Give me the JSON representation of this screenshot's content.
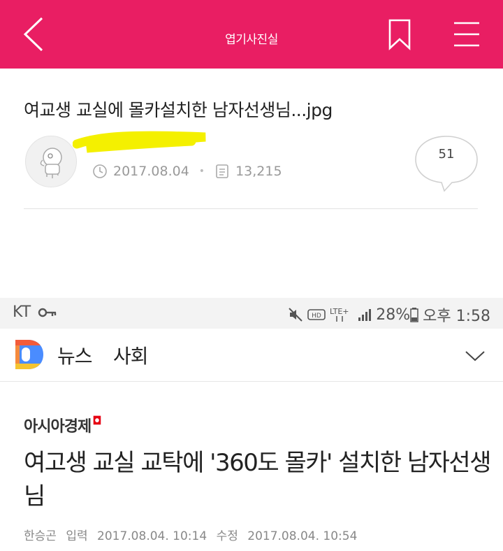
{
  "header": {
    "title": "엽기사진실",
    "background": "#e91e63",
    "icons": [
      "chevron-left-icon",
      "bookmark-icon",
      "hamburger-menu-icon"
    ]
  },
  "post": {
    "title": "여교생 교실에 몰카설치한 남자선생님...jpg",
    "date": "2017.08.04",
    "views": "13,215",
    "comment_count": "51"
  },
  "screenshot": {
    "status_bar": {
      "carrier": "KT",
      "network": "LTE+",
      "battery": "28%",
      "time": "오후 1:58"
    },
    "news_app": {
      "tab": "뉴스",
      "section": "사회"
    },
    "article": {
      "press": "아시아경제",
      "title": "여고생 교실 교탁에 '360도 몰카' 설치한 남자선생님",
      "author": "한승곤",
      "published_label": "입력",
      "published": "2017.08.04. 10:14",
      "modified_label": "수정",
      "modified": "2017.08.04. 10:54"
    }
  }
}
